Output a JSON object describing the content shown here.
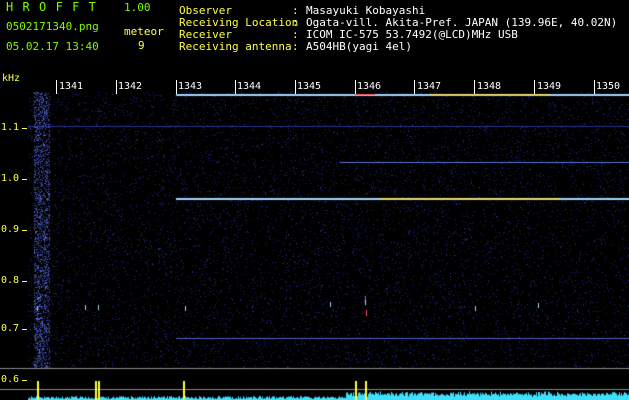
{
  "header": {
    "app_title": "HROFFT",
    "app_version": "1.00",
    "file_name": "0502171340.png",
    "meteor_label": "meteor",
    "timestamp": "05.02.17 13:40",
    "meteor_count": "9"
  },
  "station_info": [
    {
      "label": "Observer",
      "value": "Masayuki Kobayashi"
    },
    {
      "label": "Receiving Location",
      "value": "Ogata-vill. Akita-Pref. JAPAN (139.96E, 40.02N)"
    },
    {
      "label": "Receiver",
      "value": "ICOM IC-575 53.7492(@LCD)MHz USB"
    },
    {
      "label": "Receiving antenna",
      "value": "A504HB(yagi 4el)"
    }
  ],
  "separator": ":",
  "plot": {
    "y_unit": "kHz",
    "y_ticks": [
      "1.1",
      "1.0",
      "0.9",
      "0.8",
      "0.7",
      "0.6"
    ],
    "x_ticks": [
      "1341",
      "1342",
      "1343",
      "1344",
      "1345",
      "1346",
      "1347",
      "1348",
      "1349",
      "1350"
    ],
    "colors": {
      "background": "#000000",
      "noise": "#1a1f6e",
      "carrier": "#9fd6ff",
      "echo_hot": "#ff5050",
      "echo_warm": "#ffe060",
      "histogram": "#3fe0ff",
      "histogram_spike": "#ffff40"
    }
  }
}
